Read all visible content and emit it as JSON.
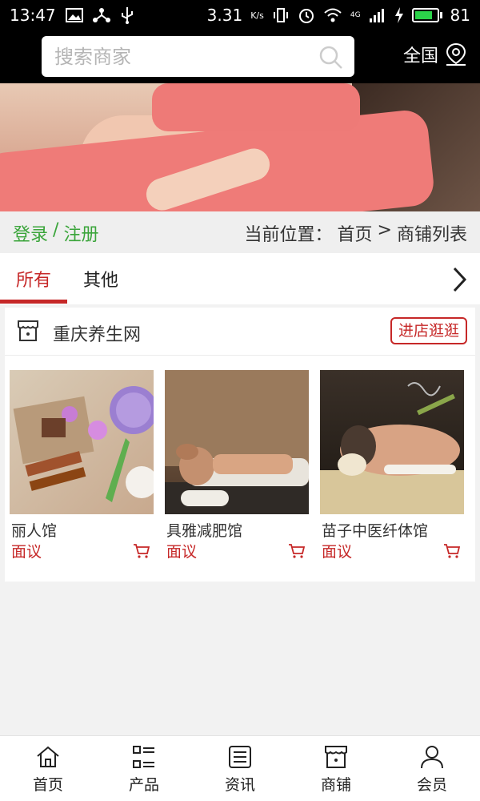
{
  "status_bar": {
    "time": "13:47",
    "speed": "3.31",
    "speed_unit": "K/s",
    "network": "4G",
    "battery": "81",
    "battery_level": 0.81,
    "icons": [
      "image-icon",
      "share-icon",
      "usb-icon",
      "vibrate-icon",
      "alarm-icon",
      "wifi-icon",
      "signal-icon",
      "charging-icon",
      "battery-icon"
    ]
  },
  "header": {
    "search_placeholder": "搜索商家",
    "region_label": "全国"
  },
  "breadcrumb": {
    "login": "登录",
    "separator": "/",
    "register": "注册",
    "location_label": "当前位置：",
    "home": "首页",
    "arrow": ">",
    "current": "商铺列表"
  },
  "tabs": [
    {
      "label": "所有",
      "active": true
    },
    {
      "label": "其他",
      "active": false
    }
  ],
  "shop": {
    "name": "重庆养生网",
    "visit_button": "进店逛逛",
    "products": [
      {
        "name": "丽人馆",
        "price": "面议"
      },
      {
        "name": "具雅减肥馆",
        "price": "面议"
      },
      {
        "name": "苗子中医纤体馆",
        "price": "面议"
      }
    ]
  },
  "bottom_nav": [
    {
      "label": "首页",
      "icon": "home-icon"
    },
    {
      "label": "产品",
      "icon": "list-icon"
    },
    {
      "label": "资讯",
      "icon": "news-icon"
    },
    {
      "label": "商铺",
      "icon": "store-icon"
    },
    {
      "label": "会员",
      "icon": "user-icon"
    }
  ],
  "colors": {
    "accent": "#c62828",
    "login_green": "#3ba53b",
    "header_bg": "#000000"
  }
}
